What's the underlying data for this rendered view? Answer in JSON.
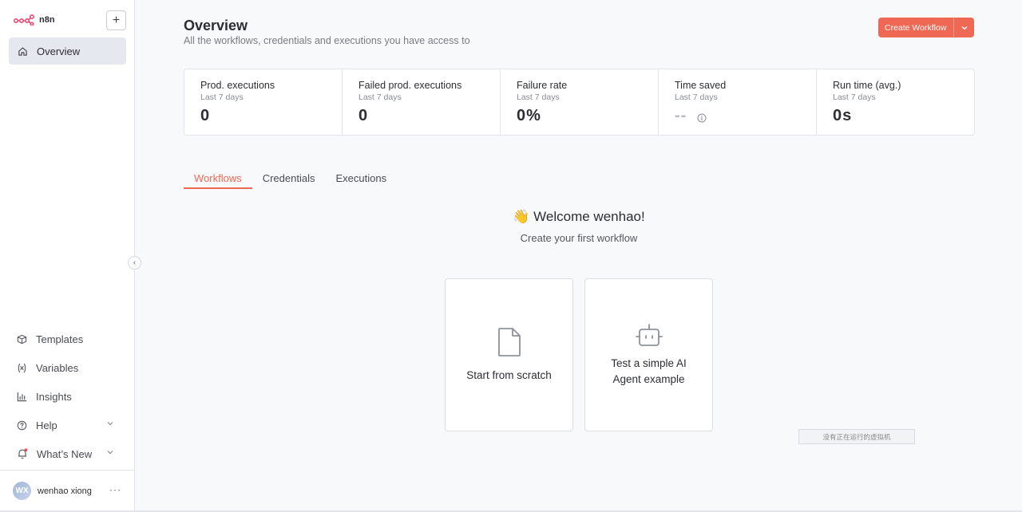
{
  "app": {
    "name": "n8n"
  },
  "sidebar": {
    "overview_label": "Overview",
    "items": [
      {
        "label": "Templates",
        "icon": "box-icon"
      },
      {
        "label": "Variables",
        "icon": "variable-icon"
      },
      {
        "label": "Insights",
        "icon": "bar-chart-icon"
      },
      {
        "label": "Help",
        "icon": "help-circle-icon"
      },
      {
        "label": "What’s New",
        "icon": "bell-icon"
      }
    ],
    "user": {
      "initials": "WX",
      "name": "wenhao xiong"
    }
  },
  "header": {
    "title": "Overview",
    "subtitle": "All the workflows, credentials and executions you have access to",
    "create_label": "Create Workflow"
  },
  "stats": [
    {
      "title": "Prod. executions",
      "period": "Last 7 days",
      "value": "0"
    },
    {
      "title": "Failed prod. executions",
      "period": "Last 7 days",
      "value": "0"
    },
    {
      "title": "Failure rate",
      "period": "Last 7 days",
      "value": "0%"
    },
    {
      "title": "Time saved",
      "period": "Last 7 days",
      "value": "--"
    },
    {
      "title": "Run time (avg.)",
      "period": "Last 7 days",
      "value": "0s"
    }
  ],
  "tabs": [
    "Workflows",
    "Credentials",
    "Executions"
  ],
  "welcome": {
    "title": "👋 Welcome wenhao!",
    "subtitle": "Create your first workflow"
  },
  "cards": {
    "scratch": "Start from scratch",
    "ai_line1": "Test a simple AI",
    "ai_line2": "Agent example"
  },
  "vm_status": "没有正在运行的虚拟机",
  "colors": {
    "accent": "#ee6853",
    "notification_dot": "#e5484d"
  }
}
